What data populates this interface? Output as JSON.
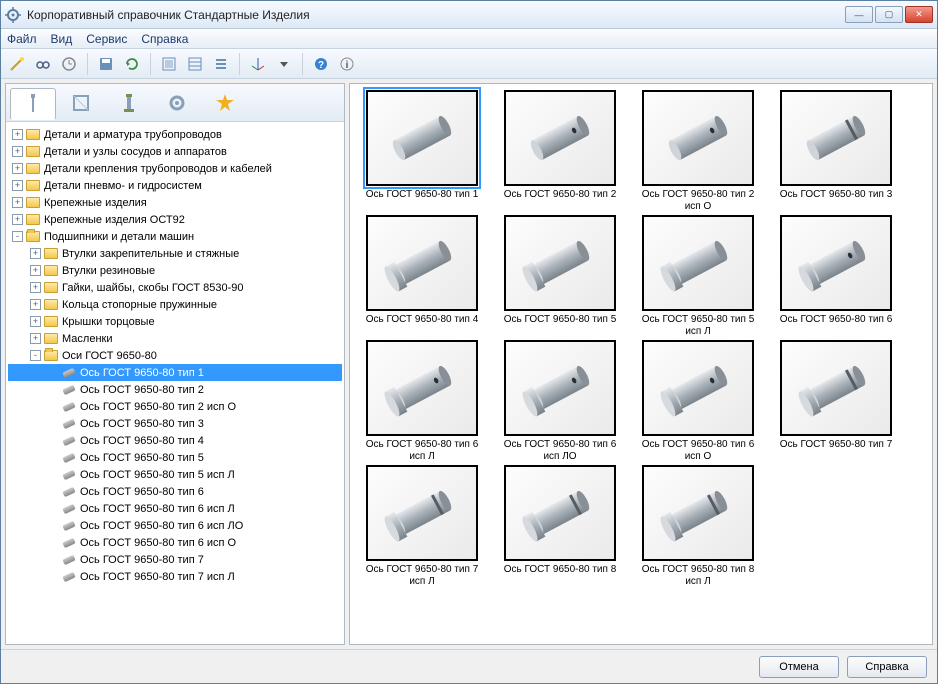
{
  "title": "Корпоративный справочник Стандартные Изделия",
  "menu": {
    "file": "Файл",
    "view": "Вид",
    "service": "Сервис",
    "help": "Справка"
  },
  "tree": [
    {
      "level": 0,
      "toggle": "+",
      "icon": "folder",
      "label": "Детали и арматура трубопроводов"
    },
    {
      "level": 0,
      "toggle": "+",
      "icon": "folder",
      "label": "Детали и узлы сосудов и аппаратов"
    },
    {
      "level": 0,
      "toggle": "+",
      "icon": "folder",
      "label": "Детали крепления трубопроводов и кабелей"
    },
    {
      "level": 0,
      "toggle": "+",
      "icon": "folder",
      "label": "Детали пневмо- и гидросистем"
    },
    {
      "level": 0,
      "toggle": "+",
      "icon": "folder",
      "label": "Крепежные изделия"
    },
    {
      "level": 0,
      "toggle": "+",
      "icon": "folder",
      "label": "Крепежные изделия ОСТ92"
    },
    {
      "level": 0,
      "toggle": "-",
      "icon": "folder-open",
      "label": "Подшипники и детали машин"
    },
    {
      "level": 1,
      "toggle": "+",
      "icon": "folder",
      "label": "Втулки закрепительные и стяжные"
    },
    {
      "level": 1,
      "toggle": "+",
      "icon": "folder",
      "label": "Втулки резиновые"
    },
    {
      "level": 1,
      "toggle": "+",
      "icon": "folder",
      "label": "Гайки, шайбы, скобы ГОСТ 8530-90"
    },
    {
      "level": 1,
      "toggle": "+",
      "icon": "folder",
      "label": "Кольца стопорные пружинные"
    },
    {
      "level": 1,
      "toggle": "+",
      "icon": "folder",
      "label": "Крышки торцовые"
    },
    {
      "level": 1,
      "toggle": "+",
      "icon": "folder",
      "label": "Масленки"
    },
    {
      "level": 1,
      "toggle": "-",
      "icon": "folder-open",
      "label": "Оси ГОСТ 9650-80"
    },
    {
      "level": 2,
      "toggle": "",
      "icon": "part",
      "label": "Ось ГОСТ 9650-80 тип 1",
      "selected": true
    },
    {
      "level": 2,
      "toggle": "",
      "icon": "part",
      "label": "Ось ГОСТ 9650-80 тип 2"
    },
    {
      "level": 2,
      "toggle": "",
      "icon": "part",
      "label": "Ось ГОСТ 9650-80 тип 2 исп О"
    },
    {
      "level": 2,
      "toggle": "",
      "icon": "part",
      "label": "Ось ГОСТ 9650-80 тип 3"
    },
    {
      "level": 2,
      "toggle": "",
      "icon": "part",
      "label": "Ось ГОСТ 9650-80 тип 4"
    },
    {
      "level": 2,
      "toggle": "",
      "icon": "part",
      "label": "Ось ГОСТ 9650-80 тип 5"
    },
    {
      "level": 2,
      "toggle": "",
      "icon": "part",
      "label": "Ось ГОСТ 9650-80 тип 5 исп Л"
    },
    {
      "level": 2,
      "toggle": "",
      "icon": "part",
      "label": "Ось ГОСТ 9650-80 тип 6"
    },
    {
      "level": 2,
      "toggle": "",
      "icon": "part",
      "label": "Ось ГОСТ 9650-80 тип 6 исп Л"
    },
    {
      "level": 2,
      "toggle": "",
      "icon": "part",
      "label": "Ось ГОСТ 9650-80 тип 6 исп ЛО"
    },
    {
      "level": 2,
      "toggle": "",
      "icon": "part",
      "label": "Ось ГОСТ 9650-80 тип 6 исп О"
    },
    {
      "level": 2,
      "toggle": "",
      "icon": "part",
      "label": "Ось ГОСТ 9650-80 тип 7"
    },
    {
      "level": 2,
      "toggle": "",
      "icon": "part",
      "label": "Ось ГОСТ 9650-80 тип 7 исп Л"
    }
  ],
  "thumbs": [
    {
      "label": "Ось ГОСТ 9650-80 тип 1",
      "variant": "plain",
      "selected": true
    },
    {
      "label": "Ось ГОСТ 9650-80 тип 2",
      "variant": "hole1"
    },
    {
      "label": "Ось ГОСТ 9650-80 тип 2 исп О",
      "variant": "hole1"
    },
    {
      "label": "Ось ГОСТ 9650-80 тип 3",
      "variant": "groove-end"
    },
    {
      "label": "Ось ГОСТ 9650-80 тип 4",
      "variant": "head"
    },
    {
      "label": "Ось ГОСТ 9650-80 тип 5",
      "variant": "head"
    },
    {
      "label": "Ось ГОСТ 9650-80 тип 5 исп Л",
      "variant": "head"
    },
    {
      "label": "Ось ГОСТ 9650-80 тип 6",
      "variant": "head-hole"
    },
    {
      "label": "Ось ГОСТ 9650-80 тип 6 исп Л",
      "variant": "head-hole"
    },
    {
      "label": "Ось ГОСТ 9650-80 тип 6 исп ЛО",
      "variant": "head-hole"
    },
    {
      "label": "Ось ГОСТ 9650-80 тип 6 исп О",
      "variant": "head-hole"
    },
    {
      "label": "Ось ГОСТ 9650-80 тип 7",
      "variant": "head-groove"
    },
    {
      "label": "Ось ГОСТ 9650-80 тип 7 исп Л",
      "variant": "head-groove"
    },
    {
      "label": "Ось ГОСТ 9650-80 тип 8",
      "variant": "head-groove"
    },
    {
      "label": "Ось ГОСТ 9650-80 тип 8 исп Л",
      "variant": "head-groove"
    }
  ],
  "buttons": {
    "cancel": "Отмена",
    "help": "Справка"
  }
}
